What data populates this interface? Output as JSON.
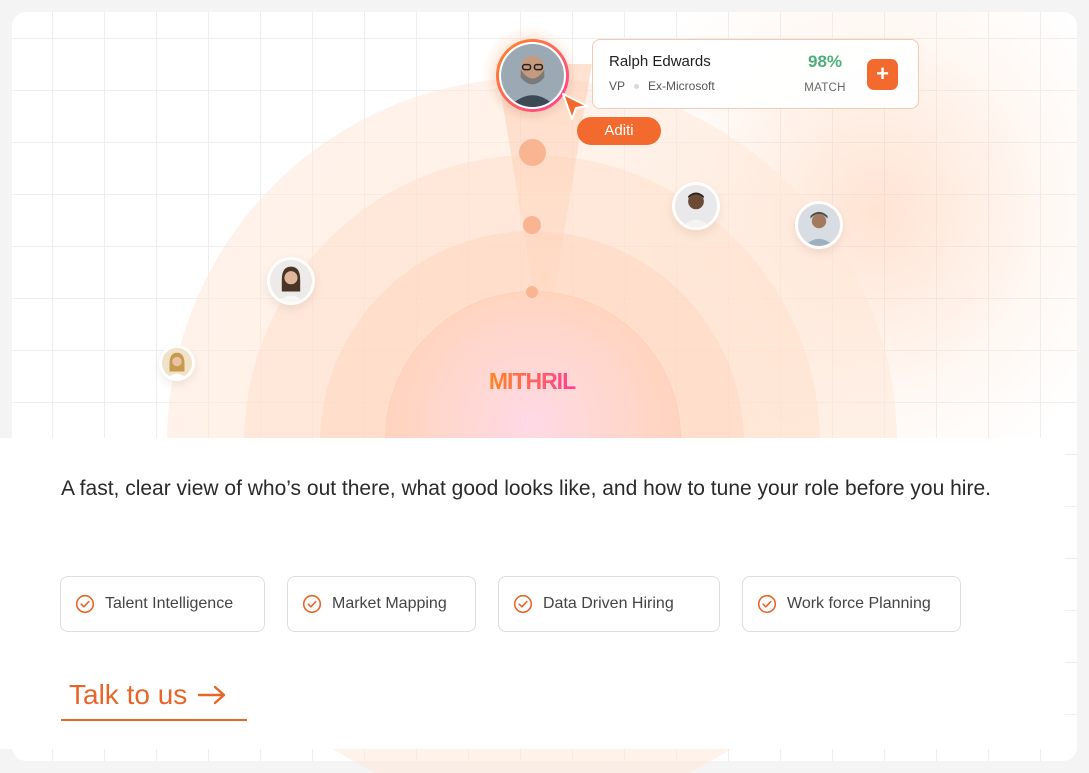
{
  "brand": {
    "name": "MITHRIL",
    "gradient_from": "#ff8a1f",
    "gradient_to": "#ff3d9a"
  },
  "candidate": {
    "name": "Ralph Edwards",
    "role": "VP",
    "company": "Ex-Microsoft",
    "match_percent": "98%",
    "match_label": "MATCH",
    "add_label": "+"
  },
  "cursor_tag": "Aditi",
  "headline": "A fast, clear view of who’s out there, what good looks like, and how to tune your role before you hire.",
  "features": [
    {
      "label": "Talent Intelligence",
      "icon": "check-circle-icon"
    },
    {
      "label": "Market Mapping",
      "icon": "check-circle-icon"
    },
    {
      "label": "Data Driven Hiring",
      "icon": "check-circle-icon"
    },
    {
      "label": "Work force Planning",
      "icon": "check-circle-icon"
    }
  ],
  "cta": {
    "label": "Talk to us",
    "icon": "arrow-right-icon"
  },
  "colors": {
    "accent": "#f26a2e",
    "match_green": "#4caf7a",
    "text": "#2a2a2a"
  }
}
